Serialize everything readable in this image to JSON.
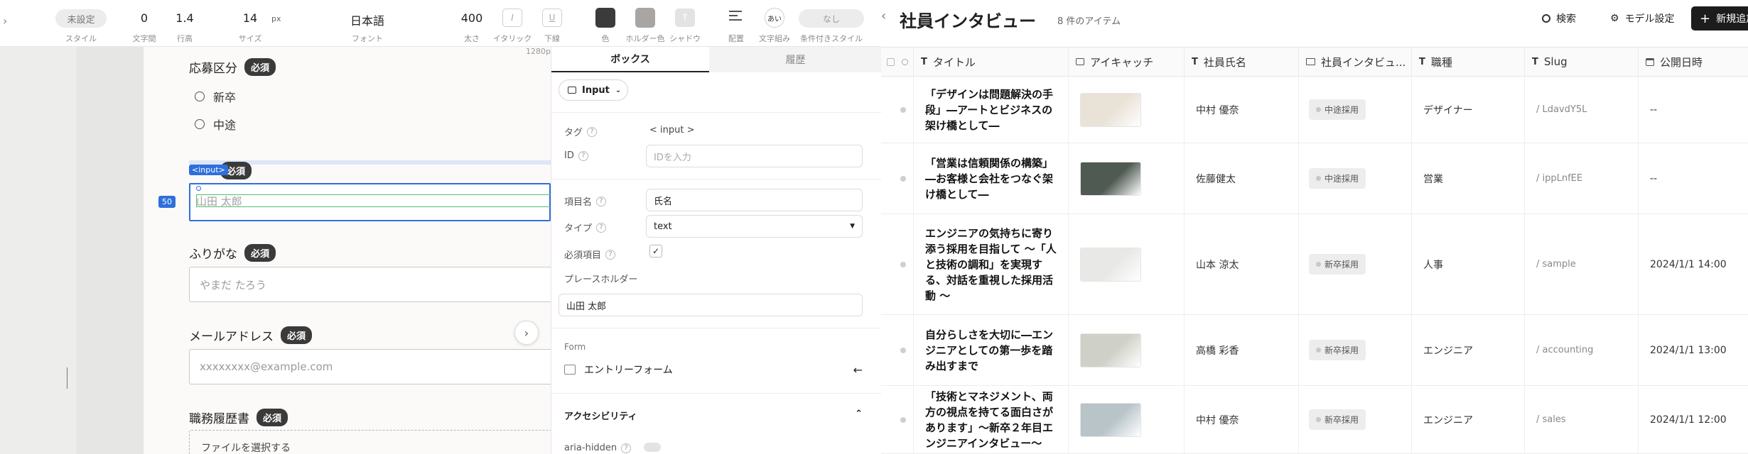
{
  "toolbar": {
    "style_value": "未設定",
    "style_label": "スタイル",
    "letter_spacing_value": "0",
    "letter_spacing_label": "文字間",
    "line_height_value": "1.4",
    "line_height_label": "行高",
    "size_value": "14",
    "size_unit": "px",
    "size_label": "サイズ",
    "font_value": "日本語",
    "font_label": "フォント",
    "weight_value": "400",
    "weight_label": "太さ",
    "italic_glyph": "I",
    "italic_label": "イタリック",
    "underline_glyph": "U",
    "underline_label": "下線",
    "color_label": "色",
    "color_hex": "#3b3b3b",
    "holder_color_label": "ホルダー色",
    "holder_color_hex": "#a9a5a3",
    "shadow_glyph": "T",
    "shadow_label": "シャドウ",
    "align_label": "配置",
    "wrap_glyph": "あい",
    "wrap_label": "文字組み",
    "conditional_value": "なし",
    "conditional_label": "条件付きスタイル"
  },
  "canvas": {
    "width_hint": "1280p",
    "field_group_label": "応募区分",
    "required_badge": "必須",
    "radio_options": [
      "新卒",
      "中途"
    ],
    "input_tag_label": "<input>",
    "width_badge": "50",
    "name_placeholder": "山田 太郎",
    "kana_label": "ふりがな",
    "kana_placeholder": "やまだ たろう",
    "email_label": "メールアドレス",
    "email_placeholder": "xxxxxxxx@example.com",
    "resume_label": "職務履歴書",
    "file_button": "ファイルを選択する"
  },
  "props": {
    "tab_box": "ボックス",
    "tab_history": "履歴",
    "element_type": "Input",
    "tag_label": "タグ",
    "tag_value": "< input >",
    "id_label": "ID",
    "id_placeholder": "IDを入力",
    "item_name_label": "項目名",
    "item_name_value": "氏名",
    "type_label": "タイプ",
    "type_value": "text",
    "required_label": "必須項目",
    "required_checked": "✓",
    "placeholder_label": "プレースホルダー",
    "placeholder_value": "山田 太郎",
    "form_section": "Form",
    "form_name": "エントリーフォーム",
    "a11y_section": "アクセシビリティ",
    "aria_hidden_label": "aria-hidden"
  },
  "collection": {
    "title": "社員インタビュー",
    "count": "8 件のアイテム",
    "search_label": "検索",
    "model_settings_label": "モデル設定",
    "new_button_label": "新規追加",
    "columns": [
      "タイトル",
      "アイキャッチ",
      "社員氏名",
      "社員インタビュ...",
      "職種",
      "Slug",
      "公開日時"
    ],
    "rows": [
      {
        "title": "「デザインは問題解決の手段」―アートとビジネスの架け橋として―",
        "name": "中村 優奈",
        "category": "中途採用",
        "job": "デザイナー",
        "slug": "/ LdavdY5L",
        "date": "--",
        "thumb": "#e9e2d6"
      },
      {
        "title": "「営業は信頼関係の構築」―お客様と会社をつなぐ架け橋として―",
        "name": "佐藤健太",
        "category": "中途採用",
        "job": "営業",
        "slug": "/ ippLnfEE",
        "date": "--",
        "thumb": "#4f5a52"
      },
      {
        "title": "エンジニアの気持ちに寄り添う採用を目指して 〜「人と技術の調和」を実現する、対話を重視した採用活動 〜",
        "name": "山本 涼太",
        "category": "新卒採用",
        "job": "人事",
        "slug": "/ sample",
        "date": "2024/1/1 14:00",
        "thumb": "#e8e8e6"
      },
      {
        "title": "自分らしさを大切に―エンジニアとしての第一歩を踏み出すまで",
        "name": "高橋 彩香",
        "category": "新卒採用",
        "job": "エンジニア",
        "slug": "/ accounting",
        "date": "2024/1/1 13:00",
        "thumb": "#cfd1c8"
      },
      {
        "title": "「技術とマネジメント、両方の視点を持てる面白さがあります」〜新卒２年目エンジニアインタビュー〜",
        "name": "中村 優奈",
        "category": "新卒採用",
        "job": "エンジニア",
        "slug": "/ sales",
        "date": "2024/1/1 12:00",
        "thumb": "#b9c4c9"
      }
    ]
  },
  "colors": {
    "accent_blue": "#2f6fdc",
    "selection_green": "#4cc36a"
  }
}
